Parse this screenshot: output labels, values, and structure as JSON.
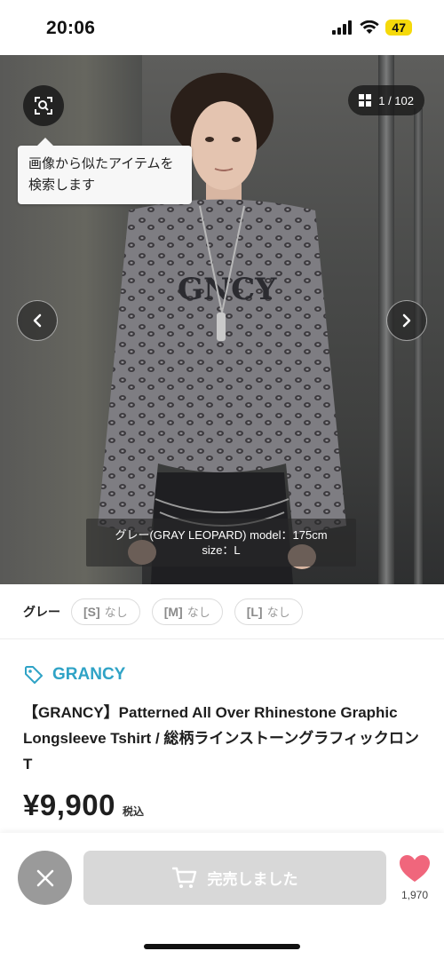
{
  "status_bar": {
    "time": "20:06",
    "battery": "47"
  },
  "gallery": {
    "search_tooltip": "画像から似たアイテムを検索します",
    "counter": "1 / 102",
    "caption_line1": "グレー(GRAY LEOPARD) model：175cm",
    "caption_line2": "size：L"
  },
  "options": {
    "color_label": "グレー",
    "sizes": [
      {
        "size": "[S]",
        "stock": "なし"
      },
      {
        "size": "[M]",
        "stock": "なし"
      },
      {
        "size": "[L]",
        "stock": "なし"
      }
    ]
  },
  "product": {
    "brand": "GRANCY",
    "title": "【GRANCY】Patterned All Over Rhinestone Graphic Longsleeve Tshirt / 総柄ラインストーングラフィックロンT",
    "price": "¥9,900",
    "tax_label": "税込"
  },
  "bottom_bar": {
    "cart_label": "完売しました",
    "favorite_count": "1,970"
  },
  "colors": {
    "brand_accent": "#2fa3c6",
    "heart": "#f0667c",
    "disabled_button": "#d8d8d8",
    "close_button": "#9a9a9a"
  },
  "icons": [
    "signal-icon",
    "wifi-icon",
    "image-search-icon",
    "grid-icon",
    "chevron-left-icon",
    "chevron-right-icon",
    "tag-icon",
    "close-icon",
    "cart-icon",
    "heart-icon"
  ]
}
